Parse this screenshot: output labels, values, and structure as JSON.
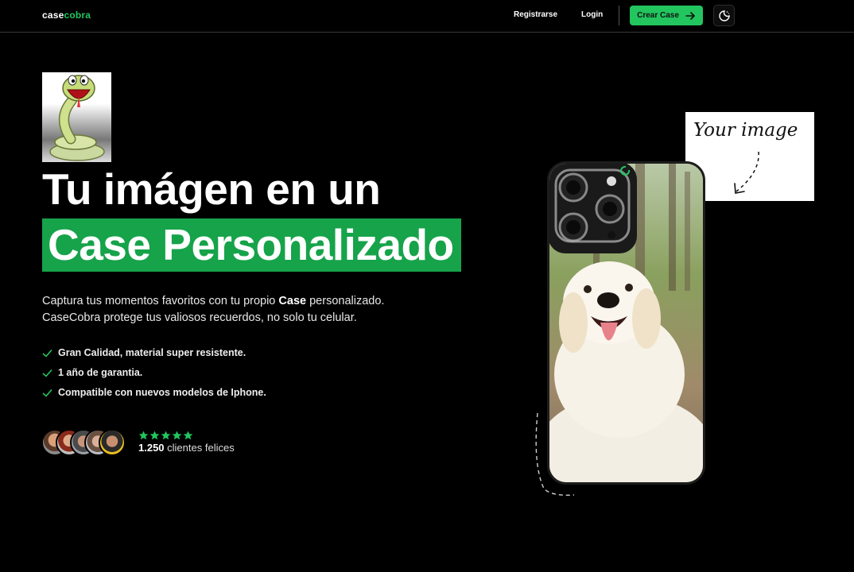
{
  "nav": {
    "logo_bold": "case",
    "logo_green": "cobra",
    "register": "Registrarse",
    "login": "Login",
    "cta": "Crear Case",
    "cta_icon": "arrow-right-icon",
    "theme_icon": "theme-toggle-icon"
  },
  "hero": {
    "title_line1": "Tu imágen en un",
    "title_line2": "Case Personalizado",
    "desc_part1": "Captura tus momentos favoritos con tu propio ",
    "desc_bold": "Case",
    "desc_part2": " personalizado.",
    "desc_line2": "CaseCobra protege tus valiosos recuerdos, no solo tu celular.",
    "features": [
      "Gran Calidad, material super resistente.",
      "1 año de garantia.",
      "Compatible con nuevos modelos de Iphone."
    ],
    "review_count": "1.250",
    "review_suffix": " clientes felices",
    "rating": 5
  },
  "showcase": {
    "your_image": "Your image"
  },
  "colors": {
    "accent": "#22c55e",
    "highlight": "#16a34a",
    "background": "#000000"
  }
}
